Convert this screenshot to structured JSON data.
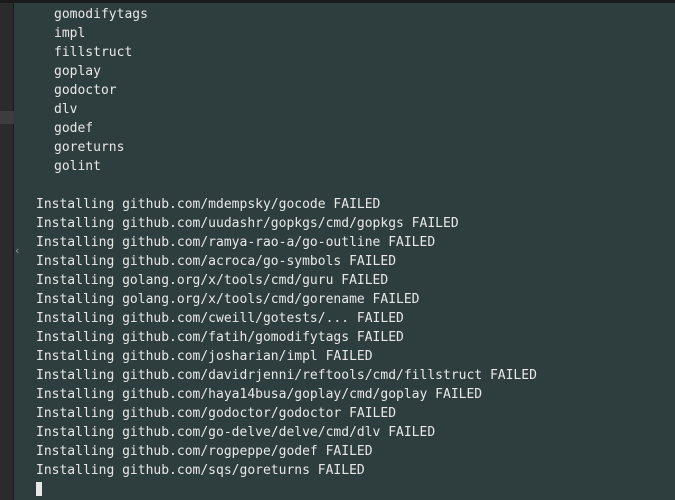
{
  "tool_list": [
    "gomodifytags",
    "impl",
    "fillstruct",
    "goplay",
    "godoctor",
    "dlv",
    "godef",
    "goreturns",
    "golint"
  ],
  "install_lines": [
    "Installing github.com/mdempsky/gocode FAILED",
    "Installing github.com/uudashr/gopkgs/cmd/gopkgs FAILED",
    "Installing github.com/ramya-rao-a/go-outline FAILED",
    "Installing github.com/acroca/go-symbols FAILED",
    "Installing golang.org/x/tools/cmd/guru FAILED",
    "Installing golang.org/x/tools/cmd/gorename FAILED",
    "Installing github.com/cweill/gotests/... FAILED",
    "Installing github.com/fatih/gomodifytags FAILED",
    "Installing github.com/josharian/impl FAILED",
    "Installing github.com/davidrjenni/reftools/cmd/fillstruct FAILED",
    "Installing github.com/haya14busa/goplay/cmd/goplay FAILED",
    "Installing github.com/godoctor/godoctor FAILED",
    "Installing github.com/go-delve/delve/cmd/dlv FAILED",
    "Installing github.com/rogpeppe/godef FAILED",
    "Installing github.com/sqs/goreturns FAILED"
  ],
  "chevron": "‹"
}
